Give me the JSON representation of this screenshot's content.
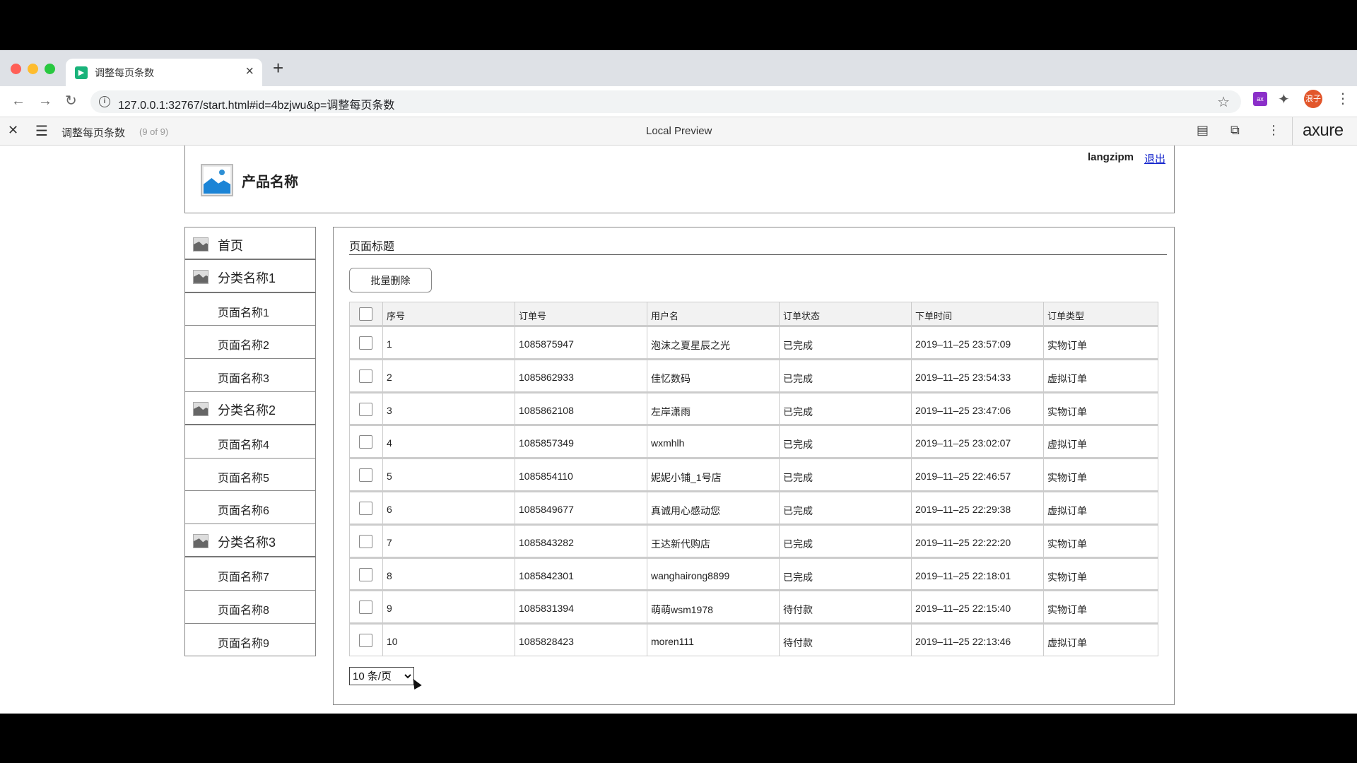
{
  "browser": {
    "tab_title": "调整每页条数",
    "url": "127.0.0.1:32767/start.html#id=4bzjwu&p=调整每页条数",
    "avatar_text": "浪子"
  },
  "axure": {
    "page_name": "调整每页条数",
    "page_count": "(9 of 9)",
    "preview_label": "Local Preview",
    "logo": "axure"
  },
  "header": {
    "product_name": "产品名称",
    "username": "langzipm",
    "logout": "退出"
  },
  "sidebar": {
    "items": [
      {
        "label": "首页",
        "type": "cat"
      },
      {
        "label": "分类名称1",
        "type": "cat"
      },
      {
        "label": "页面名称1",
        "type": "page"
      },
      {
        "label": "页面名称2",
        "type": "page"
      },
      {
        "label": "页面名称3",
        "type": "page"
      },
      {
        "label": "分类名称2",
        "type": "cat"
      },
      {
        "label": "页面名称4",
        "type": "page"
      },
      {
        "label": "页面名称5",
        "type": "page"
      },
      {
        "label": "页面名称6",
        "type": "page"
      },
      {
        "label": "分类名称3",
        "type": "cat"
      },
      {
        "label": "页面名称7",
        "type": "page"
      },
      {
        "label": "页面名称8",
        "type": "page"
      },
      {
        "label": "页面名称9",
        "type": "page"
      }
    ]
  },
  "main": {
    "title": "页面标题",
    "batch_delete": "批量删除",
    "page_size": "10 条/页"
  },
  "table": {
    "columns": [
      "序号",
      "订单号",
      "用户名",
      "订单状态",
      "下单时间",
      "订单类型"
    ],
    "rows": [
      [
        "1",
        "1085875947",
        "泡沫之夏星辰之光",
        "已完成",
        "2019–11–25 23:57:09",
        "实物订单"
      ],
      [
        "2",
        "1085862933",
        "佳忆数码",
        "已完成",
        "2019–11–25 23:54:33",
        "虚拟订单"
      ],
      [
        "3",
        "1085862108",
        "左岸潇雨",
        "已完成",
        "2019–11–25 23:47:06",
        "实物订单"
      ],
      [
        "4",
        "1085857349",
        "wxmhlh",
        "已完成",
        "2019–11–25 23:02:07",
        "虚拟订单"
      ],
      [
        "5",
        "1085854110",
        "妮妮小铺_1号店",
        "已完成",
        "2019–11–25 22:46:57",
        "实物订单"
      ],
      [
        "6",
        "1085849677",
        "真诚用心感动您",
        "已完成",
        "2019–11–25 22:29:38",
        "虚拟订单"
      ],
      [
        "7",
        "1085843282",
        "王达新代购店",
        "已完成",
        "2019–11–25 22:22:20",
        "实物订单"
      ],
      [
        "8",
        "1085842301",
        "wanghairong8899",
        "已完成",
        "2019–11–25 22:18:01",
        "实物订单"
      ],
      [
        "9",
        "1085831394",
        "萌萌wsm1978",
        "待付款",
        "2019–11–25 22:15:40",
        "实物订单"
      ],
      [
        "10",
        "1085828423",
        "moren111",
        "待付款",
        "2019–11–25 22:13:46",
        "虚拟订单"
      ]
    ]
  }
}
